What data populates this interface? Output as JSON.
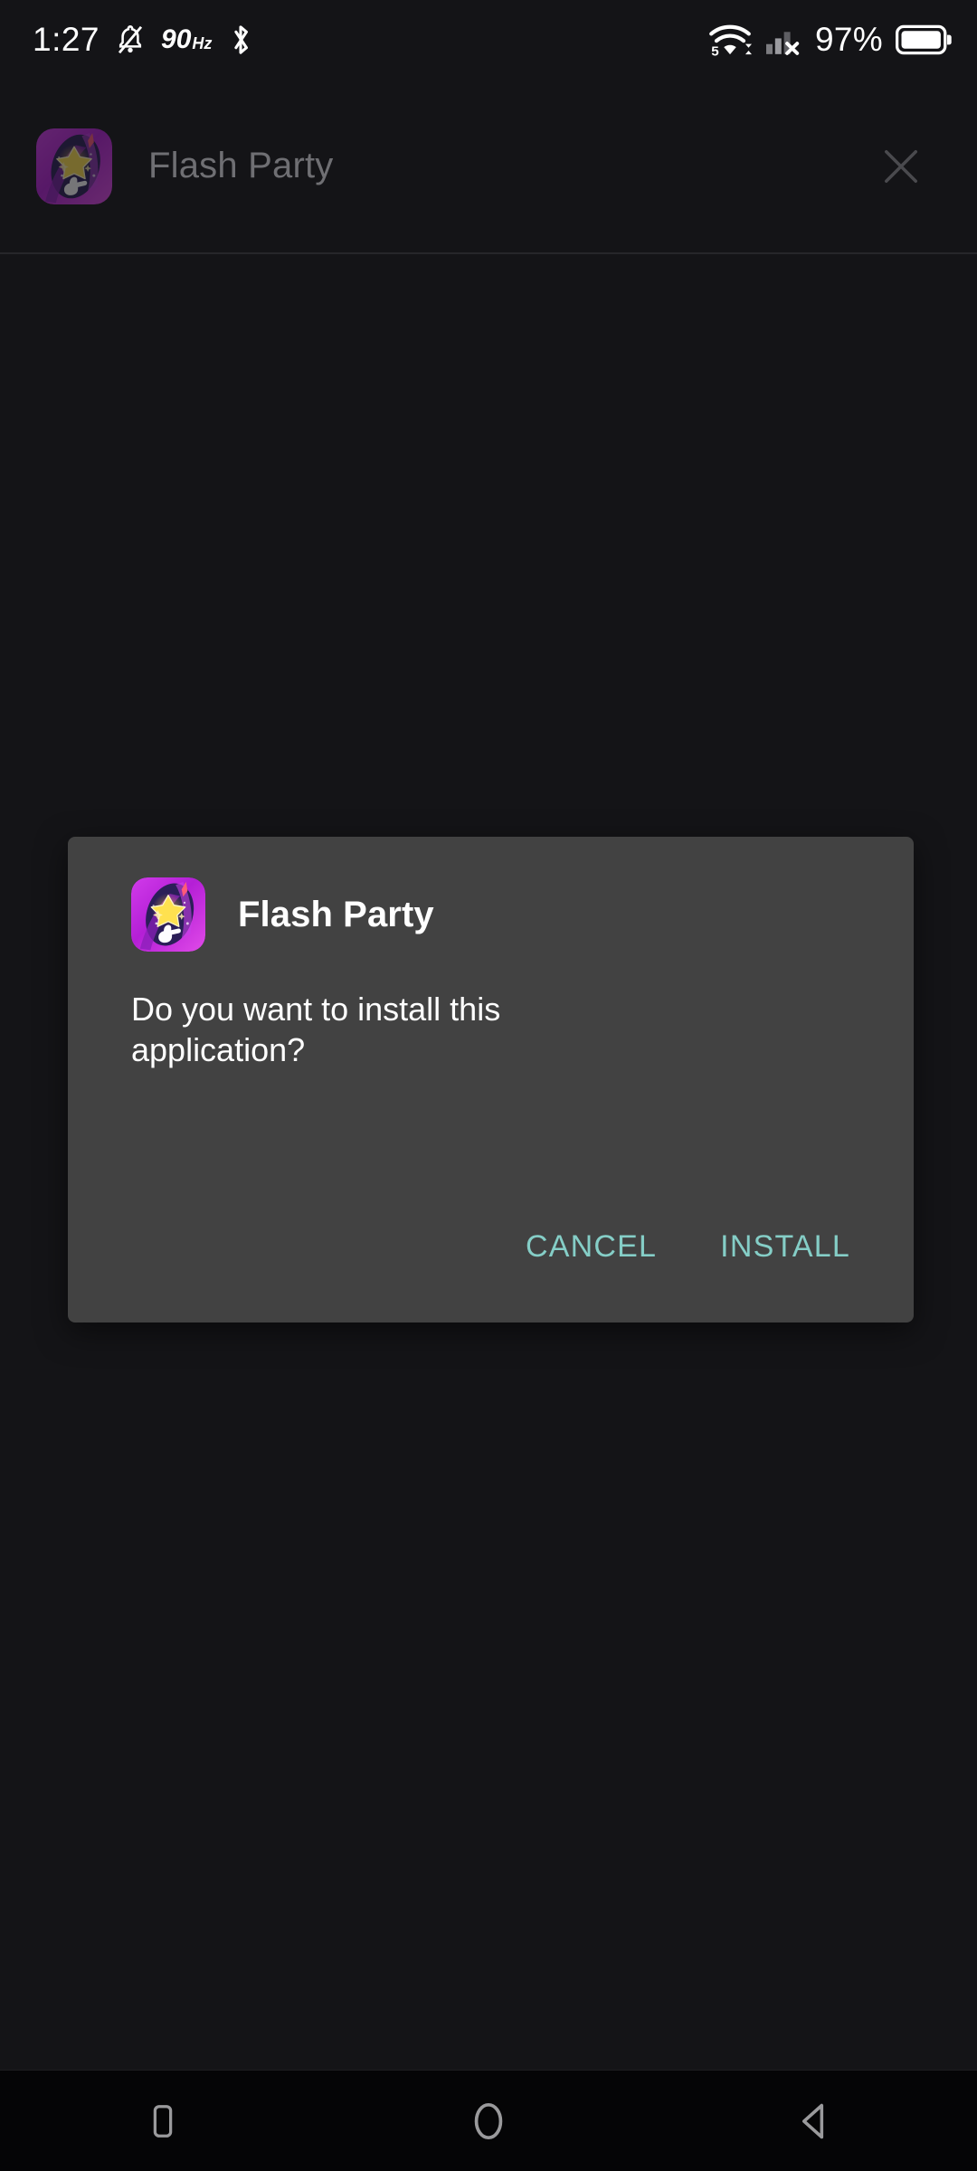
{
  "status_bar": {
    "time": "1:27",
    "silent_icon": "bell-muted-icon",
    "refresh_rate": "90",
    "refresh_rate_unit": "Hz",
    "bluetooth_icon": "bluetooth-icon",
    "wifi_icon": "wifi-5g-icon",
    "wifi_label": "5",
    "signal_icon": "cellular-no-service-icon",
    "battery_percent": "97%",
    "battery_icon": "battery-full-icon"
  },
  "app_bar": {
    "icon_name": "flash-party-app-icon",
    "title": "Flash Party",
    "close_icon": "close-icon"
  },
  "dialog": {
    "icon_name": "flash-party-app-icon",
    "title": "Flash Party",
    "message": "Do you want to install this application?",
    "cancel_label": "CANCEL",
    "install_label": "INSTALL",
    "accent_color": "#85cec7",
    "background_color": "#424242"
  },
  "nav_bar": {
    "recents_icon": "square-recents-icon",
    "home_icon": "circle-home-icon",
    "back_icon": "triangle-back-icon"
  },
  "theme": {
    "page_background": "#141417",
    "nav_background": "#050506",
    "divider": "#26262a"
  }
}
